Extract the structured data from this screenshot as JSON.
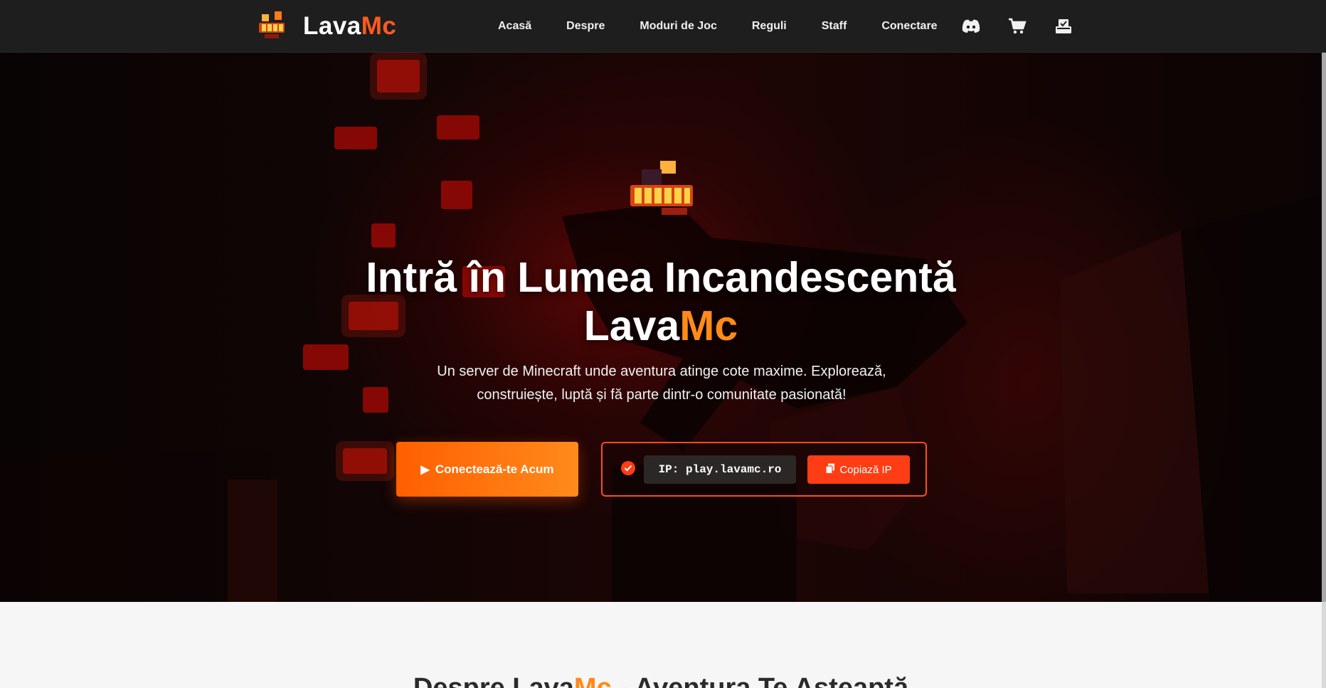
{
  "nav": {
    "brand_part1": "Lava",
    "brand_part2": "Mc",
    "links": [
      "Acasă",
      "Despre",
      "Moduri de Joc",
      "Reguli",
      "Staff",
      "Conectare"
    ],
    "icons": [
      "discord-icon",
      "cart-icon",
      "vote-icon"
    ]
  },
  "hero": {
    "title_line1": "Intră în Lumea Incandescentă",
    "title_part1": "Lava",
    "title_part2": "Mc",
    "subtitle": "Un server de Minecraft unde aventura atinge cote maxime. Explorează, construiește, luptă și fă parte dintr-o comunitate pasionată!",
    "cta_label": "Conectează-te Acum",
    "ip_text": "IP: play.lavamc.ro",
    "copy_label": "Copiază IP"
  },
  "about": {
    "title_part1": "Despre Lava",
    "title_part2": "Mc",
    "title_part3": " - Aventura Te Așteaptă"
  },
  "colors": {
    "accent_orange": "#ff8a1a",
    "accent_red": "#ff3d14",
    "navbar": "#1e1e1e"
  }
}
